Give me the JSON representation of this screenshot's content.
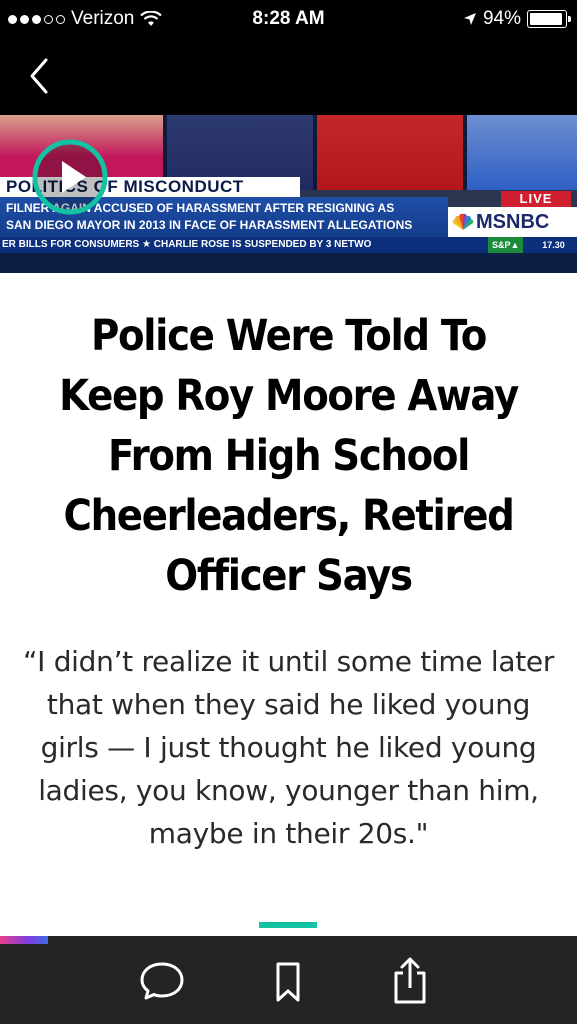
{
  "status_bar": {
    "carrier": "Verizon",
    "time": "8:28 AM",
    "battery_percent": "94%",
    "battery_level": 0.94,
    "signal_bars_filled": 3,
    "signal_bars_total": 5
  },
  "nav": {
    "back_icon": "chevron-left-icon"
  },
  "video": {
    "chyron_title": "POLITICS OF MISCONDUCT",
    "chyron_line1": "FILNER AGAIN ACCUSED OF HARASSMENT AFTER RESIGNING AS",
    "chyron_line2": "SAN DIEGO MAYOR IN 2013 IN FACE OF HARASSMENT ALLEGATIONS",
    "live_label": "LIVE",
    "network": "MSNBC",
    "ticker": "ER BILLS FOR CONSUMERS   ★  CHARLIE ROSE IS SUSPENDED BY 3 NETWO",
    "market_label": "S&P▲",
    "market_value": "17.30",
    "play_icon": "play-icon"
  },
  "article": {
    "headline": "Police Were Told To Keep Roy Moore Away From High School Cheerleaders, Retired Officer Says",
    "dek": "“I didn’t realize it until some time later that when they said he liked young girls — I just thought he liked young ladies, you know, younger than him, maybe in their 20s.\""
  },
  "colors": {
    "accent": "#12c2a2",
    "toolbar_bg": "#242424",
    "status_bg": "#000000"
  },
  "toolbar": {
    "items": [
      {
        "icon": "comment-icon"
      },
      {
        "icon": "bookmark-icon"
      },
      {
        "icon": "share-icon"
      }
    ]
  }
}
